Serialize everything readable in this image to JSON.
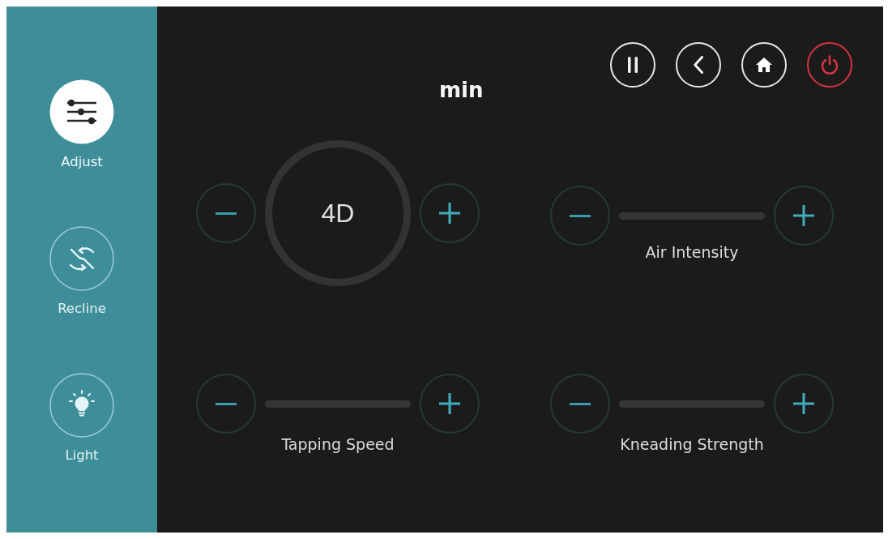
{
  "sidebar": {
    "items": [
      {
        "label": "Adjust",
        "selected": true
      },
      {
        "label": "Recline",
        "selected": false
      },
      {
        "label": "Light",
        "selected": false
      }
    ]
  },
  "title": "min",
  "controls": [
    {
      "kind": "dial",
      "value": "4D"
    },
    {
      "kind": "slider",
      "label": "Air Intensity"
    },
    {
      "kind": "slider",
      "label": "Tapping Speed"
    },
    {
      "kind": "slider",
      "label": "Kneading Strength"
    }
  ]
}
